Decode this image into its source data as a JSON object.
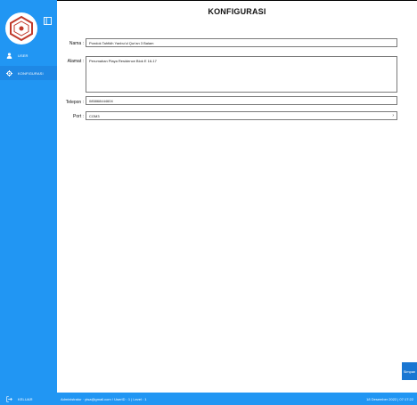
{
  "page_title": "KONFIGURASI",
  "sidebar": {
    "items": [
      {
        "label": "USER",
        "icon": "user-icon"
      },
      {
        "label": "KONFIGURASI",
        "icon": "gear-icon",
        "active": true
      }
    ],
    "logout_label": "KELUAR",
    "accent": "#2196f3"
  },
  "form": {
    "nama_label": "Nama :",
    "nama_value": "Pondok Tahfidh Yanbu'ul Qur'an 3 Balam",
    "alamat_label": "Alamat :",
    "alamat_value": "Perumahan Playa Residence Blok E 16-17",
    "telepon_label": "Telepon :",
    "telepon_value": "085868444604",
    "port_label": "Port :",
    "port_value": "COM3"
  },
  "save_label": "Simpan",
  "status": {
    "user_info": "Administrator · ytsa@gmail.com / UserID : 1 | Level : 1",
    "datetime": "18 Desember 2022 | 07:17:22"
  }
}
